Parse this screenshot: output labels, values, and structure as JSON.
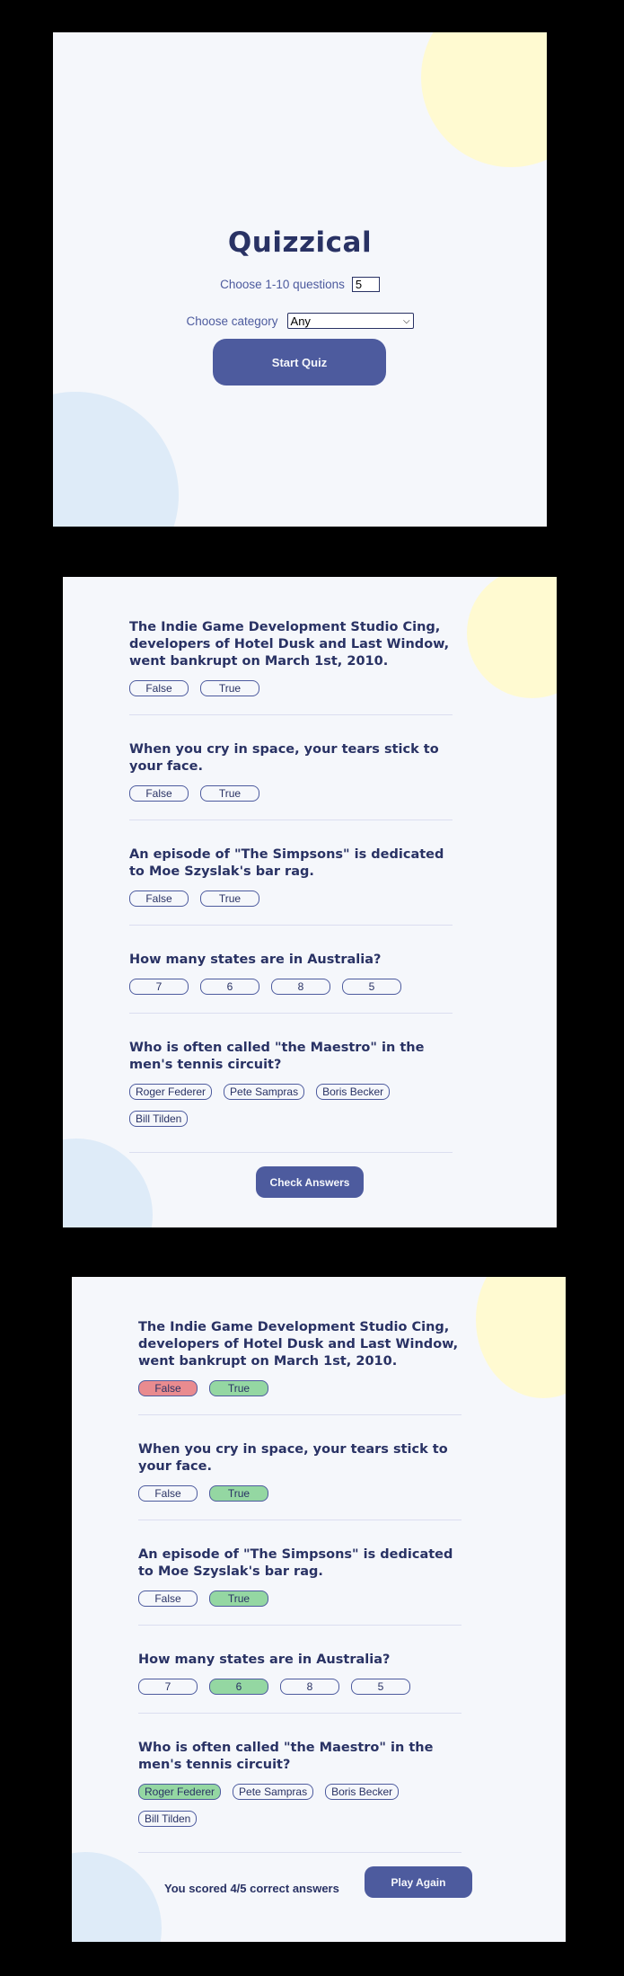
{
  "start": {
    "title": "Quizzical",
    "questions_label": "Choose 1-10 questions",
    "questions_value": "5",
    "category_label": "Choose category",
    "category_value": "Any",
    "start_button": "Start Quiz"
  },
  "quiz": {
    "questions": [
      {
        "text": "The Indie Game Development Studio Cing, developers of Hotel Dusk and Last Window, went bankrupt on March 1st, 2010.",
        "answers": [
          "False",
          "True"
        ]
      },
      {
        "text": "When you cry in space, your tears stick to your face.",
        "answers": [
          "False",
          "True"
        ]
      },
      {
        "text": "An episode of \"The Simpsons\" is dedicated to Moe Szyslak's bar rag.",
        "answers": [
          "False",
          "True"
        ]
      },
      {
        "text": "How many states are in Australia?",
        "answers": [
          "7",
          "6",
          "8",
          "5"
        ]
      },
      {
        "text": "Who is often called \"the Maestro\" in the men's tennis circuit?",
        "answers": [
          "Roger Federer",
          "Pete Sampras",
          "Boris Becker",
          "Bill Tilden"
        ]
      }
    ],
    "check_button": "Check Answers"
  },
  "results": {
    "score_text": "You scored 4/5 correct answers",
    "play_again_button": "Play Again",
    "states": {
      "q0": {
        "wrong": "False",
        "correct": "True"
      },
      "q1": {
        "correct": "True"
      },
      "q2": {
        "correct": "True"
      },
      "q3": {
        "correct": "6"
      },
      "q4": {
        "correct": "Roger Federer"
      }
    }
  },
  "colors": {
    "background": "#F5F7FB",
    "primary": "#4D5B9E",
    "text": "#293264",
    "correct": "#94D7A2",
    "wrong": "#E98B8F",
    "blob_yellow": "#FFFAD1",
    "blob_blue": "#DEEBF8"
  }
}
